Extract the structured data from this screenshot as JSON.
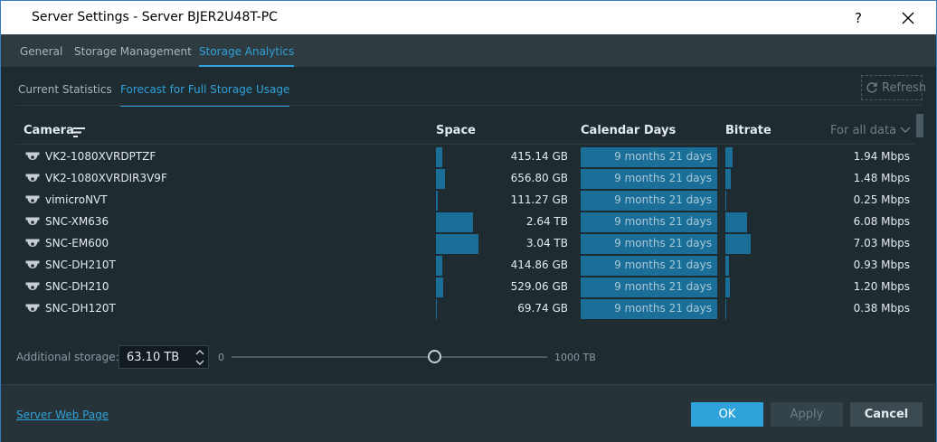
{
  "window": {
    "title": "Server Settings - Server BJER2U48T-PC",
    "help_label": "?"
  },
  "tabs": [
    {
      "label": "General"
    },
    {
      "label": "Storage Management"
    },
    {
      "label": "Storage Analytics"
    }
  ],
  "active_tab": "Storage Analytics",
  "subtabs": [
    {
      "label": "Current Statistics"
    },
    {
      "label": "Forecast for Full Storage Usage"
    }
  ],
  "active_subtab": "Forecast for Full Storage Usage",
  "refresh_label": "Refresh",
  "table": {
    "columns": {
      "camera": "Camera",
      "space": "Space",
      "days": "Calendar Days",
      "bitrate": "Bitrate",
      "scope": "For all data"
    },
    "rows": [
      {
        "camera": "VK2-1080XVRDPTZF",
        "space": "415.14 GB",
        "days": "9 months 21 days",
        "bitrate": "1.94 Mbps",
        "space_fraction": 0.14,
        "bitrate_fraction": 0.28
      },
      {
        "camera": "VK2-1080XVRDIR3V9F",
        "space": "656.80 GB",
        "days": "9 months 21 days",
        "bitrate": "1.48 Mbps",
        "space_fraction": 0.22,
        "bitrate_fraction": 0.21
      },
      {
        "camera": "vimicroNVT",
        "space": "111.27 GB",
        "days": "9 months 21 days",
        "bitrate": "0.25 Mbps",
        "space_fraction": 0.04,
        "bitrate_fraction": 0.04
      },
      {
        "camera": "SNC-XM636",
        "space": "2.64 TB",
        "days": "9 months 21 days",
        "bitrate": "6.08 Mbps",
        "space_fraction": 0.87,
        "bitrate_fraction": 0.86
      },
      {
        "camera": "SNC-EM600",
        "space": "3.04 TB",
        "days": "9 months 21 days",
        "bitrate": "7.03 Mbps",
        "space_fraction": 1.0,
        "bitrate_fraction": 1.0
      },
      {
        "camera": "SNC-DH210T",
        "space": "414.86 GB",
        "days": "9 months 21 days",
        "bitrate": "0.93 Mbps",
        "space_fraction": 0.14,
        "bitrate_fraction": 0.13
      },
      {
        "camera": "SNC-DH210",
        "space": "529.06 GB",
        "days": "9 months 21 days",
        "bitrate": "1.20 Mbps",
        "space_fraction": 0.17,
        "bitrate_fraction": 0.17
      },
      {
        "camera": "SNC-DH120T",
        "space": "69.74 GB",
        "days": "9 months 21 days",
        "bitrate": "0.38 Mbps",
        "space_fraction": 0.02,
        "bitrate_fraction": 0.05
      }
    ]
  },
  "additional_storage": {
    "label": "Additional storage:",
    "value": "63.10 TB",
    "min_label": "0",
    "max_label": "1000 TB",
    "slider_fraction": 0.645
  },
  "footer": {
    "web_link": "Server Web Page",
    "ok_label": "OK",
    "apply_label": "Apply",
    "cancel_label": "Cancel"
  },
  "colors": {
    "accent": "#2fa2db",
    "bar": "#1a6e97",
    "background": "#1e2b31"
  },
  "icons": {
    "camera": "dome-camera-icon",
    "sort": "sort-icon",
    "refresh": "refresh-icon",
    "close": "close-icon",
    "dropdown": "chevron-down-icon"
  }
}
